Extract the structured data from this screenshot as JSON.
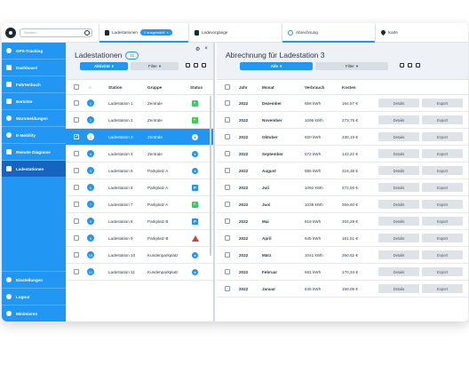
{
  "topbar": {
    "search_placeholder": "Suchen",
    "tabs": [
      {
        "label": "Ladestationen",
        "badge": "1 ausgewählt"
      },
      {
        "label": "Ladevorgänge"
      },
      {
        "label": "Abrechnung"
      },
      {
        "label": "Karte"
      }
    ]
  },
  "sidebar": {
    "items": [
      {
        "label": "GPS-Tracking"
      },
      {
        "label": "Dashboard"
      },
      {
        "label": "Fahrtenbuch"
      },
      {
        "label": "Berichte"
      },
      {
        "label": "Warnmeldungen"
      },
      {
        "label": "E-Mobility"
      },
      {
        "label": "Remote Diagnose"
      },
      {
        "label": "Ladestationen"
      }
    ],
    "bottom": [
      {
        "label": "Einstellungen"
      },
      {
        "label": "Logout"
      },
      {
        "label": "Minimieren"
      }
    ]
  },
  "left": {
    "title": "Ladestationen",
    "count": "11",
    "filter_active": "Aktivität",
    "filter": "Filter",
    "columns": {
      "station": "Station",
      "gruppe": "Gruppe",
      "status": "Status"
    },
    "rows": [
      {
        "num": "1",
        "station": "Ladestation 1",
        "gruppe": "Zentrale",
        "status": "green",
        "glyph": "⚡"
      },
      {
        "num": "2",
        "station": "Ladestation 2",
        "gruppe": "Zentrale",
        "status": "green",
        "glyph": "⚡"
      },
      {
        "num": "3",
        "station": "Ladestation 3",
        "gruppe": "Zentrale",
        "status": "blue-circle",
        "glyph": "●"
      },
      {
        "num": "4",
        "station": "Ladestation 4",
        "gruppe": "Zentrale",
        "status": "blue-circle",
        "glyph": "●"
      },
      {
        "num": "5",
        "station": "Ladestation 5",
        "gruppe": "Parkplatz A",
        "status": "blue-circle",
        "glyph": "●"
      },
      {
        "num": "6",
        "station": "Ladestation 6",
        "gruppe": "Parkplatz A",
        "status": "blue-sq",
        "glyph": "P"
      },
      {
        "num": "7",
        "station": "Ladestation 7",
        "gruppe": "Parkplatz A",
        "status": "green",
        "glyph": "⚡"
      },
      {
        "num": "8",
        "station": "Ladestation 8",
        "gruppe": "Parkplatz B",
        "status": "blue-sq",
        "glyph": "P"
      },
      {
        "num": "9",
        "station": "Ladestation 9",
        "gruppe": "Parkplatz B",
        "status": "warn",
        "glyph": "!"
      },
      {
        "num": "10",
        "station": "Ladestation 10",
        "gruppe": "Kundenparkplatz",
        "status": "blue-circle",
        "glyph": "●"
      },
      {
        "num": "11",
        "station": "Ladestation 11",
        "gruppe": "Kundenparkplatz",
        "status": "blue-circle",
        "glyph": "●"
      }
    ],
    "selected_index": 2
  },
  "right": {
    "title": "Abrechnung für Ladestation 3",
    "filter_active": "Alle",
    "filter": "Filter",
    "columns": {
      "jahr": "Jahr",
      "monat": "Monat",
      "verbrauch": "Verbrauch",
      "kosten": "Kosten"
    },
    "details_label": "Details",
    "export_label": "Export",
    "rows": [
      {
        "jahr": "2022",
        "monat": "Dezember",
        "verbrauch": "658 kWh",
        "kosten": "164,57 €"
      },
      {
        "jahr": "2022",
        "monat": "November",
        "verbrauch": "1096 kWh",
        "kosten": "273,78 €"
      },
      {
        "jahr": "2022",
        "monat": "Oktober",
        "verbrauch": "920 kWh",
        "kosten": "230,19 €"
      },
      {
        "jahr": "2022",
        "monat": "September",
        "verbrauch": "572 kWh",
        "kosten": "143,22 €"
      },
      {
        "jahr": "2022",
        "monat": "August",
        "verbrauch": "865 kWh",
        "kosten": "216,38 €"
      },
      {
        "jahr": "2022",
        "monat": "Juli",
        "verbrauch": "1092 kWh",
        "kosten": "272,50 €"
      },
      {
        "jahr": "2022",
        "monat": "Juni",
        "verbrauch": "1038 kWh",
        "kosten": "259,60 €"
      },
      {
        "jahr": "2022",
        "monat": "Mai",
        "verbrauch": "819 kWh",
        "kosten": "204,29 €"
      },
      {
        "jahr": "2022",
        "monat": "April",
        "verbrauch": "645 kWh",
        "kosten": "161,51 €"
      },
      {
        "jahr": "2022",
        "monat": "März",
        "verbrauch": "1041 kWh",
        "kosten": "260,62 €"
      },
      {
        "jahr": "2022",
        "monat": "Februar",
        "verbrauch": "681 kWh",
        "kosten": "170,34 €"
      },
      {
        "jahr": "2022",
        "monat": "Januar",
        "verbrauch": "636 kWh",
        "kosten": "159,09 €"
      }
    ]
  }
}
